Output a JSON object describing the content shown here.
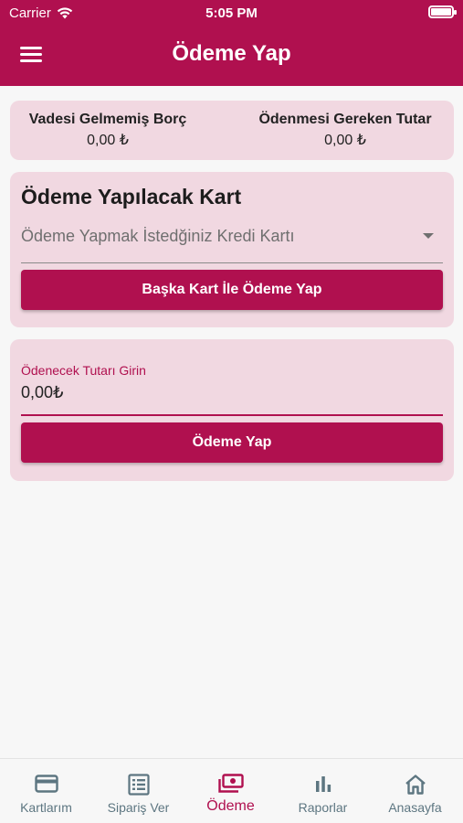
{
  "status_bar": {
    "carrier": "Carrier",
    "time": "5:05 PM"
  },
  "header": {
    "title": "Ödeme Yap"
  },
  "summary": {
    "left_title": "Vadesi Gelmemiş Borç",
    "left_value": "0,00 ₺",
    "right_title": "Ödenmesi Gereken Tutar",
    "right_value": "0,00 ₺"
  },
  "card_section": {
    "title": "Ödeme Yapılacak Kart",
    "dropdown_placeholder": "Ödeme Yapmak İstedğiniz Kredi Kartı",
    "other_card_button": "Başka Kart İle Ödeme Yap"
  },
  "amount_section": {
    "label": "Ödenecek Tutarı Girin",
    "value": "0,00₺",
    "pay_button": "Ödeme Yap"
  },
  "bottom_nav": {
    "items": [
      {
        "label": "Kartlarım",
        "icon": "credit-card-icon"
      },
      {
        "label": "Sipariş Ver",
        "icon": "order-list-icon"
      },
      {
        "label": "Ödeme",
        "icon": "payment-icon",
        "active": true
      },
      {
        "label": "Raporlar",
        "icon": "bar-chart-icon"
      },
      {
        "label": "Anasayfa",
        "icon": "home-icon"
      }
    ]
  },
  "colors": {
    "primary": "#b0104f",
    "card_bg": "#f1d8e1",
    "nav_inactive": "#5d7681"
  }
}
